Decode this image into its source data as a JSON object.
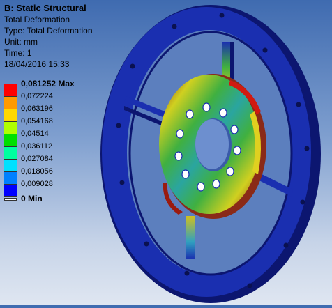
{
  "header": {
    "title": "B: Static Structural",
    "result_name": "Total Deformation",
    "type": "Type: Total Deformation",
    "unit": "Unit: mm",
    "time": "Time: 1",
    "date": "18/04/2016 15:33"
  },
  "legend": {
    "max_label": "0,081252 Max",
    "min_label": "0 Min",
    "values": [
      "0,072224",
      "0,063196",
      "0,054168",
      "0,04514",
      "0,036112",
      "0,027084",
      "0,018056",
      "0,009028"
    ],
    "colors": [
      "#ff0000",
      "#ff9a00",
      "#ffd800",
      "#b0ff00",
      "#00e000",
      "#00ffa0",
      "#00e0ff",
      "#0080ff",
      "#0000ff"
    ]
  },
  "colors": {
    "ring_blue": "#1a2fb0",
    "ring_dark": "#0c1670",
    "hub_green": "#33aa44",
    "hub_yellow": "#e0d82a",
    "hub_red": "#b52010"
  }
}
